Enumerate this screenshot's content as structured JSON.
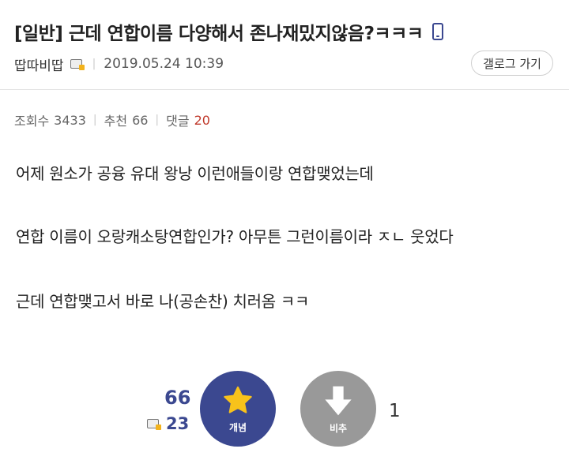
{
  "post": {
    "title": "[일반] 근데 연합이름 다양해서 존나재밌지않음?ㅋㅋㅋ",
    "author": "땁따비땁",
    "date": "2019.05.24 10:39",
    "gallery_button": "갤로그 가기"
  },
  "stats": {
    "views_label": "조회수",
    "views": "3433",
    "recommend_label": "추천",
    "recommend": "66",
    "comments_label": "댓글",
    "comments": "20"
  },
  "body": {
    "lines": [
      "어제 원소가 공융 유대 왕낭 이런애들이랑 연합맺었는데",
      "연합 이름이 오랑캐소탕연합인가? 아무튼 그런이름이라 ㅈㄴ 웃었다",
      "근데 연합맺고서 바로 나(공손찬) 치러옴 ㅋㅋ"
    ]
  },
  "votes": {
    "up_count": "66",
    "fixed_count": "23",
    "up_label": "개념",
    "down_label": "비추",
    "down_count": "1"
  },
  "colors": {
    "accent": "#3b4890",
    "down_button": "#999999",
    "comment_count": "#c0392b",
    "star": "#f8c21b"
  }
}
